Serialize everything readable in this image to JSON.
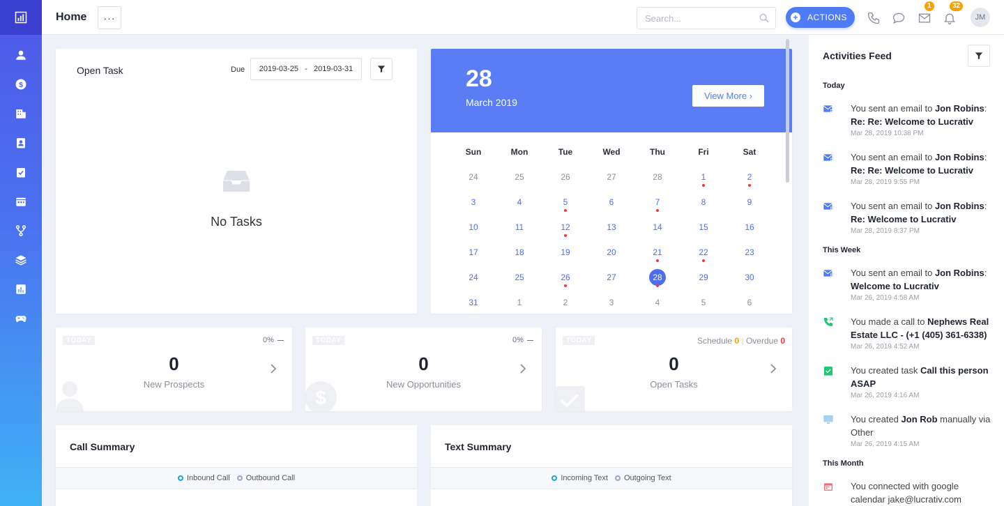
{
  "header": {
    "page_title": "Home",
    "more_label": "···",
    "search_placeholder": "Search...",
    "actions_label": "ACTIONS",
    "email_badge": "1",
    "notification_badge": "32",
    "avatar_initials": "JM"
  },
  "sidebar": {
    "items": [
      "logo-icon",
      "person-icon",
      "dollar-icon",
      "building-icon",
      "contact-card-icon",
      "clipboard-check-icon",
      "calendar-icon",
      "branch-icon",
      "layers-icon",
      "bar-chart-icon",
      "gamepad-icon"
    ]
  },
  "open_task": {
    "title": "Open Task",
    "due_label": "Due",
    "date_range": "2019-03-25   -   2019-03-31",
    "empty_text": "No Tasks"
  },
  "calendar": {
    "day": "28",
    "month_year": "March 2019",
    "view_more": "View More ›",
    "weekdays": [
      "Sun",
      "Mon",
      "Tue",
      "Wed",
      "Thu",
      "Fri",
      "Sat"
    ],
    "weeks": [
      [
        {
          "d": "24",
          "m": "dim"
        },
        {
          "d": "25",
          "m": "dim"
        },
        {
          "d": "26",
          "m": "dim"
        },
        {
          "d": "27",
          "m": "dim"
        },
        {
          "d": "28",
          "m": "dim"
        },
        {
          "d": "1",
          "m": "cur",
          "dot": true
        },
        {
          "d": "2",
          "m": "cur",
          "dot": true
        }
      ],
      [
        {
          "d": "3",
          "m": "cur"
        },
        {
          "d": "4",
          "m": "cur"
        },
        {
          "d": "5",
          "m": "cur",
          "dot": true
        },
        {
          "d": "6",
          "m": "cur"
        },
        {
          "d": "7",
          "m": "cur",
          "dot": true
        },
        {
          "d": "8",
          "m": "cur"
        },
        {
          "d": "9",
          "m": "cur"
        }
      ],
      [
        {
          "d": "10",
          "m": "cur"
        },
        {
          "d": "11",
          "m": "cur"
        },
        {
          "d": "12",
          "m": "cur",
          "dot": true
        },
        {
          "d": "13",
          "m": "cur"
        },
        {
          "d": "14",
          "m": "cur"
        },
        {
          "d": "15",
          "m": "cur"
        },
        {
          "d": "16",
          "m": "cur"
        }
      ],
      [
        {
          "d": "17",
          "m": "cur"
        },
        {
          "d": "18",
          "m": "cur"
        },
        {
          "d": "19",
          "m": "cur"
        },
        {
          "d": "20",
          "m": "cur"
        },
        {
          "d": "21",
          "m": "cur",
          "dot": true
        },
        {
          "d": "22",
          "m": "cur",
          "dot": true
        },
        {
          "d": "23",
          "m": "cur"
        }
      ],
      [
        {
          "d": "24",
          "m": "cur"
        },
        {
          "d": "25",
          "m": "cur"
        },
        {
          "d": "26",
          "m": "cur",
          "dot": true
        },
        {
          "d": "27",
          "m": "cur"
        },
        {
          "d": "28",
          "m": "cur",
          "selected": true,
          "dot": true
        },
        {
          "d": "29",
          "m": "cur"
        },
        {
          "d": "30",
          "m": "cur"
        }
      ],
      [
        {
          "d": "31",
          "m": "cur"
        },
        {
          "d": "1",
          "m": "dim"
        },
        {
          "d": "2",
          "m": "dim"
        },
        {
          "d": "3",
          "m": "dim"
        },
        {
          "d": "4",
          "m": "dim"
        },
        {
          "d": "5",
          "m": "dim"
        },
        {
          "d": "6",
          "m": "dim"
        }
      ]
    ]
  },
  "stats": {
    "prospects": {
      "today": "TODAY",
      "pct": "0%",
      "value": "0",
      "label": "New Prospects"
    },
    "opportunities": {
      "today": "TODAY",
      "pct": "0%",
      "value": "0",
      "label": "New Opportunities"
    },
    "tasks": {
      "today": "TODAY",
      "schedule_label": "Schedule",
      "schedule_value": "0",
      "overdue_label": "Overdue",
      "overdue_value": "0",
      "value": "0",
      "label": "Open Tasks"
    }
  },
  "call_summary": {
    "title": "Call Summary",
    "legend": [
      "Inbound Call",
      "Outbound Call"
    ]
  },
  "text_summary": {
    "title": "Text Summary",
    "legend": [
      "Incoming Text",
      "Outgoing Text"
    ]
  },
  "feed": {
    "title": "Activities Feed",
    "sections": {
      "today": "Today",
      "week": "This Week",
      "month": "This Month"
    },
    "entries": [
      {
        "pre": "You sent an email to ",
        "bold": "Jon Robins",
        "post": ":",
        "bold2": "Re: Re: Welcome to Lucrativ",
        "time": "Mar 28, 2019 10:38 PM"
      },
      {
        "pre": "You sent an email to ",
        "bold": "Jon Robins",
        "post": ":",
        "bold2": "Re: Re: Welcome to Lucrativ",
        "time": "Mar 28, 2019 9:55 PM"
      },
      {
        "pre": "You sent an email to ",
        "bold": "Jon Robins",
        "post": ":",
        "bold2": "Re: Welcome to Lucrativ",
        "time": "Mar 28, 2019 8:37 PM"
      },
      {
        "pre": "You sent an email to ",
        "bold": "Jon Robins",
        "post": ":",
        "bold2": "Welcome to Lucrativ",
        "time": "Mar 26, 2019 4:58 AM"
      },
      {
        "pre": "You made a call to ",
        "bold": "Nephews Real Estate LLC - (+1 (405) 361-6338)",
        "post": "",
        "bold2": "",
        "time": "Mar 26, 2019 4:52 AM"
      },
      {
        "pre": "You created task ",
        "bold": "Call this person ASAP",
        "post": "",
        "bold2": "",
        "time": "Mar 26, 2019 4:16 AM"
      },
      {
        "pre": "You created ",
        "bold": "Jon Rob",
        "post": " manually via Other",
        "bold2": "",
        "time": "Mar 26, 2019 4:15 AM"
      },
      {
        "pre": "You connected with google calendar jake@lucrativ.com",
        "bold": "",
        "post": "",
        "bold2": "",
        "time": ""
      }
    ]
  },
  "colors": {
    "accent": "#4e7cf6",
    "calendar_header": "#5a7df6",
    "badge": "#f6a200",
    "dot": "#f23a3a"
  }
}
